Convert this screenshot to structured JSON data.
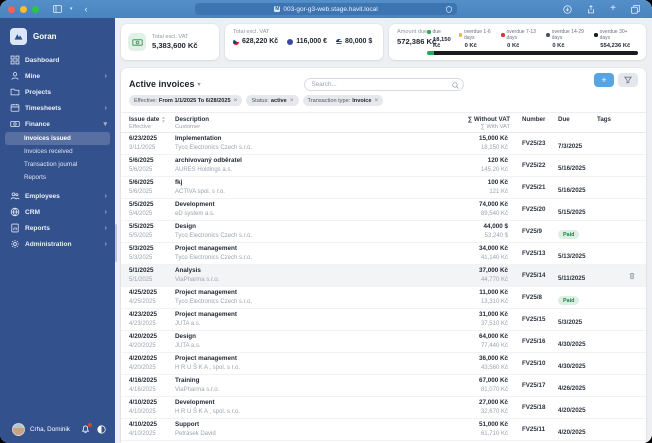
{
  "icons": {
    "chevron_right": "›",
    "chevron_down_small": "▾",
    "close": "×",
    "plus": "+",
    "sort": "⇅"
  },
  "colors": {
    "accent": "#55a4e4",
    "sidebar": "#33518d",
    "paid_bg": "#dcefe3",
    "paid_text": "#23804a"
  },
  "browser": {
    "url": "003-gor-g3-web.stage.havit.local"
  },
  "sidebar": {
    "app_name": "Goran",
    "items": [
      {
        "label": "Dashboard"
      },
      {
        "label": "Mine",
        "expandable": true
      },
      {
        "label": "Projects"
      },
      {
        "label": "Timesheets",
        "expandable": true
      },
      {
        "label": "Finance",
        "expanded": true
      }
    ],
    "finance_children": [
      {
        "label": "Invoices issued",
        "active": true
      },
      {
        "label": "Invoices received"
      },
      {
        "label": "Transaction journal"
      },
      {
        "label": "Reports"
      }
    ],
    "items_bottom": [
      {
        "label": "Employees",
        "expandable": true
      },
      {
        "label": "CRM",
        "expandable": true
      },
      {
        "label": "Reports",
        "expandable": true
      },
      {
        "label": "Administration",
        "expandable": true
      }
    ],
    "user": {
      "name": "Crha, Dominik"
    }
  },
  "stats": {
    "total_single": {
      "label": "Total excl. VAT",
      "value": "5,383,600 Kč"
    },
    "total_by_currency": {
      "label": "Total excl. VAT",
      "amounts": [
        {
          "flag": "czk",
          "value": "628,220 Kč"
        },
        {
          "flag": "eur",
          "value": "116,000 €"
        },
        {
          "flag": "usd",
          "value": "80,000 $"
        }
      ]
    },
    "amount_due": {
      "label": "Amount due",
      "value": "572,386 Kč",
      "buckets": [
        {
          "label": "due",
          "value": "18,150 Kč",
          "color": "#2fa45b"
        },
        {
          "label": "overdue 1-6 days",
          "value": "0 Kč",
          "color": "#f2b63c"
        },
        {
          "label": "overdue 7-13 days",
          "value": "0 Kč",
          "color": "#d43a2b"
        },
        {
          "label": "overdue 14-29 days",
          "value": "0 Kč",
          "color": "#4c535e"
        },
        {
          "label": "overdue 30+ days",
          "value": "554,236 Kč",
          "color": "#181b20"
        }
      ],
      "bar_segments": [
        {
          "color": "#2fa45b",
          "pct": 3.2
        },
        {
          "color": "#181b20",
          "pct": 96.8
        }
      ]
    }
  },
  "toolbar": {
    "title": "Active invoices",
    "search_placeholder": "Search..."
  },
  "filters": [
    {
      "label": "Effective:",
      "value": "From 1/1/2025 To 6/28/2025"
    },
    {
      "label": "Status:",
      "value": "active"
    },
    {
      "label": "Transaction type:",
      "value": "Invoice"
    }
  ],
  "table": {
    "headers": {
      "issue_date": "Issue date",
      "effective": "Effective",
      "description": "Description",
      "customer": "Customer",
      "without_vat": "∑ Without VAT",
      "with_vat": "∑ With VAT",
      "number": "Number",
      "due": "Due",
      "tags": "Tags"
    },
    "paid_label": "Paid",
    "rows": [
      {
        "issue": "6/23/2025",
        "effective": "3/11/2025",
        "description": "Implementation",
        "customer": "Tyco Electronics Czech s.r.o.",
        "without_vat": "15,000 Kč",
        "with_vat": "18,150 Kč",
        "number": "FV25/23",
        "due": "7/3/2025"
      },
      {
        "issue": "5/6/2025",
        "effective": "5/6/2025",
        "description": "archivovaný odběratel",
        "customer": "AURES Holdings a.s.",
        "without_vat": "120 Kč",
        "with_vat": "145.20 Kč",
        "number": "FV25/22",
        "due": "5/16/2025"
      },
      {
        "issue": "5/6/2025",
        "effective": "5/6/2025",
        "description": "fkj",
        "customer": "ACTIVA spol. s r.o.",
        "without_vat": "100 Kč",
        "with_vat": "121 Kč",
        "number": "FV25/21",
        "due": "5/16/2025"
      },
      {
        "issue": "5/5/2025",
        "effective": "5/4/2025",
        "description": "Development",
        "customer": "eD system a.s.",
        "without_vat": "74,000 Kč",
        "with_vat": "89,540 Kč",
        "number": "FV25/20",
        "due": "5/15/2025"
      },
      {
        "issue": "5/5/2025",
        "effective": "5/5/2025",
        "description": "Design",
        "customer": "Tyco Electronics Czech s.r.o.",
        "without_vat": "44,000 $",
        "with_vat": "53,240 $",
        "number": "FV25/9",
        "paid": true
      },
      {
        "issue": "5/3/2025",
        "effective": "5/3/2025",
        "description": "Project management",
        "customer": "Tyco Electronics Czech s.r.o.",
        "without_vat": "34,000 Kč",
        "with_vat": "41,140 Kč",
        "number": "FV25/13",
        "due": "5/13/2025"
      },
      {
        "issue": "5/1/2025",
        "effective": "5/1/2025",
        "description": "Analysis",
        "customer": "ViaPharma s.r.o.",
        "without_vat": "37,000 Kč",
        "with_vat": "44,770 Kč",
        "number": "FV25/14",
        "due": "5/11/2025",
        "highlighted": true
      },
      {
        "issue": "4/25/2025",
        "effective": "4/25/2025",
        "description": "Project management",
        "customer": "Tyco Electronics Czech s.r.o.",
        "without_vat": "11,000 Kč",
        "with_vat": "13,310 Kč",
        "number": "FV25/8",
        "paid": true
      },
      {
        "issue": "4/23/2025",
        "effective": "4/23/2025",
        "description": "Project management",
        "customer": "JUTA a.s.",
        "without_vat": "31,000 Kč",
        "with_vat": "37,510 Kč",
        "number": "FV25/15",
        "due": "5/3/2025"
      },
      {
        "issue": "4/20/2025",
        "effective": "4/20/2025",
        "description": "Design",
        "customer": "JUTA a.s.",
        "without_vat": "64,000 Kč",
        "with_vat": "77,440 Kč",
        "number": "FV25/16",
        "due": "4/30/2025"
      },
      {
        "issue": "4/20/2025",
        "effective": "4/20/2025",
        "description": "Project management",
        "customer": "H R U Š K A , spol. s r.o.",
        "without_vat": "36,000 Kč",
        "with_vat": "43,560 Kč",
        "number": "FV25/10",
        "due": "4/30/2025"
      },
      {
        "issue": "4/16/2025",
        "effective": "4/16/2025",
        "description": "Training",
        "customer": "ViaPharma s.r.o.",
        "without_vat": "67,000 Kč",
        "with_vat": "81,070 Kč",
        "number": "FV25/17",
        "due": "4/26/2025"
      },
      {
        "issue": "4/10/2025",
        "effective": "4/10/2025",
        "description": "Development",
        "customer": "H R U Š K A , spol. s r.o.",
        "without_vat": "27,000 Kč",
        "with_vat": "32,670 Kč",
        "number": "FV25/18",
        "due": "4/20/2025"
      },
      {
        "issue": "4/10/2025",
        "effective": "4/10/2025",
        "description": "Support",
        "customer": "Petrásek David",
        "without_vat": "51,000 Kč",
        "with_vat": "61,710 Kč",
        "number": "FV25/11",
        "due": "4/20/2025"
      }
    ]
  }
}
